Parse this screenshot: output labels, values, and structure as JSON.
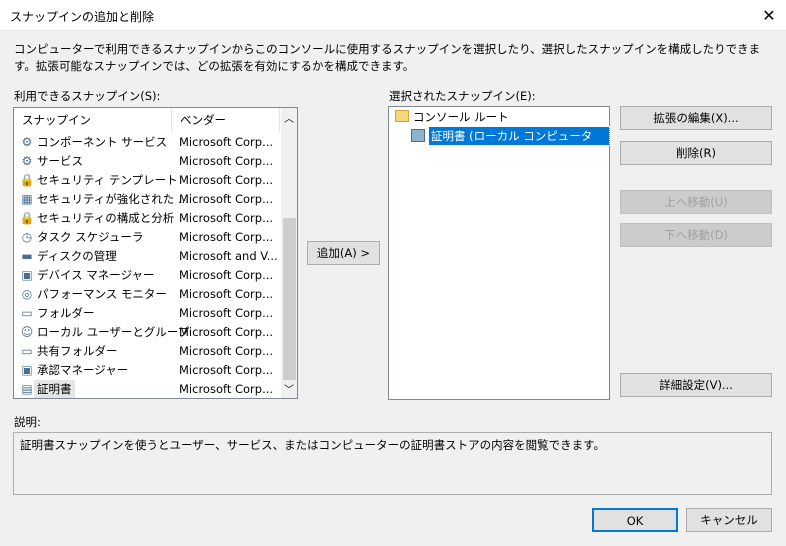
{
  "window": {
    "title": "スナップインの追加と削除",
    "close_icon": "close-icon"
  },
  "intro": "コンピューターで利用できるスナップインからこのコンソールに使用するスナップインを選択したり、選択したスナップインを構成したりできます。拡張可能なスナップインでは、どの拡張を有効にするかを構成できます。",
  "available": {
    "label": "利用できるスナップイン(S):",
    "columns": [
      "スナップイン",
      "ベンダー"
    ],
    "items": [
      {
        "name": "コンポーネント サービス",
        "vendor": "Microsoft Corp...",
        "icon": "component-services-icon"
      },
      {
        "name": "サービス",
        "vendor": "Microsoft Corp...",
        "icon": "gear-icon"
      },
      {
        "name": "セキュリティ テンプレート",
        "vendor": "Microsoft Corp...",
        "icon": "security-template-icon"
      },
      {
        "name": "セキュリティが強化された ...",
        "vendor": "Microsoft Corp...",
        "icon": "firewall-icon"
      },
      {
        "name": "セキュリティの構成と分析",
        "vendor": "Microsoft Corp...",
        "icon": "security-analysis-icon"
      },
      {
        "name": "タスク スケジューラ",
        "vendor": "Microsoft Corp...",
        "icon": "clock-icon"
      },
      {
        "name": "ディスクの管理",
        "vendor": "Microsoft and V...",
        "icon": "disk-icon"
      },
      {
        "name": "デバイス マネージャー",
        "vendor": "Microsoft Corp...",
        "icon": "device-manager-icon"
      },
      {
        "name": "パフォーマンス モニター",
        "vendor": "Microsoft Corp...",
        "icon": "performance-icon"
      },
      {
        "name": "フォルダー",
        "vendor": "Microsoft Corp...",
        "icon": "folder-icon"
      },
      {
        "name": "ローカル ユーザーとグループ",
        "vendor": "Microsoft Corp...",
        "icon": "users-icon"
      },
      {
        "name": "共有フォルダー",
        "vendor": "Microsoft Corp...",
        "icon": "shared-folder-icon"
      },
      {
        "name": "承認マネージャー",
        "vendor": "Microsoft Corp...",
        "icon": "authorization-icon"
      },
      {
        "name": "証明書",
        "vendor": "Microsoft Corp...",
        "icon": "certificate-icon"
      }
    ]
  },
  "add_button": "追加(A) >",
  "selected": {
    "label": "選択されたスナップイン(E):",
    "root": "コンソール ルート",
    "child": "証明書 (ローカル コンピューター)"
  },
  "buttons": {
    "edit_ext": "拡張の編集(X)...",
    "remove": "削除(R)",
    "move_up": "上へ移動(U)",
    "move_down": "下へ移動(D)",
    "advanced": "詳細設定(V)...",
    "ok": "OK",
    "cancel": "キャンセル"
  },
  "description": {
    "label": "説明:",
    "text": "証明書スナップインを使うとユーザー、サービス、またはコンピューターの証明書ストアの内容を閲覧できます。"
  },
  "colors": {
    "selection": "#0078d7",
    "accent": "#0078d7"
  }
}
